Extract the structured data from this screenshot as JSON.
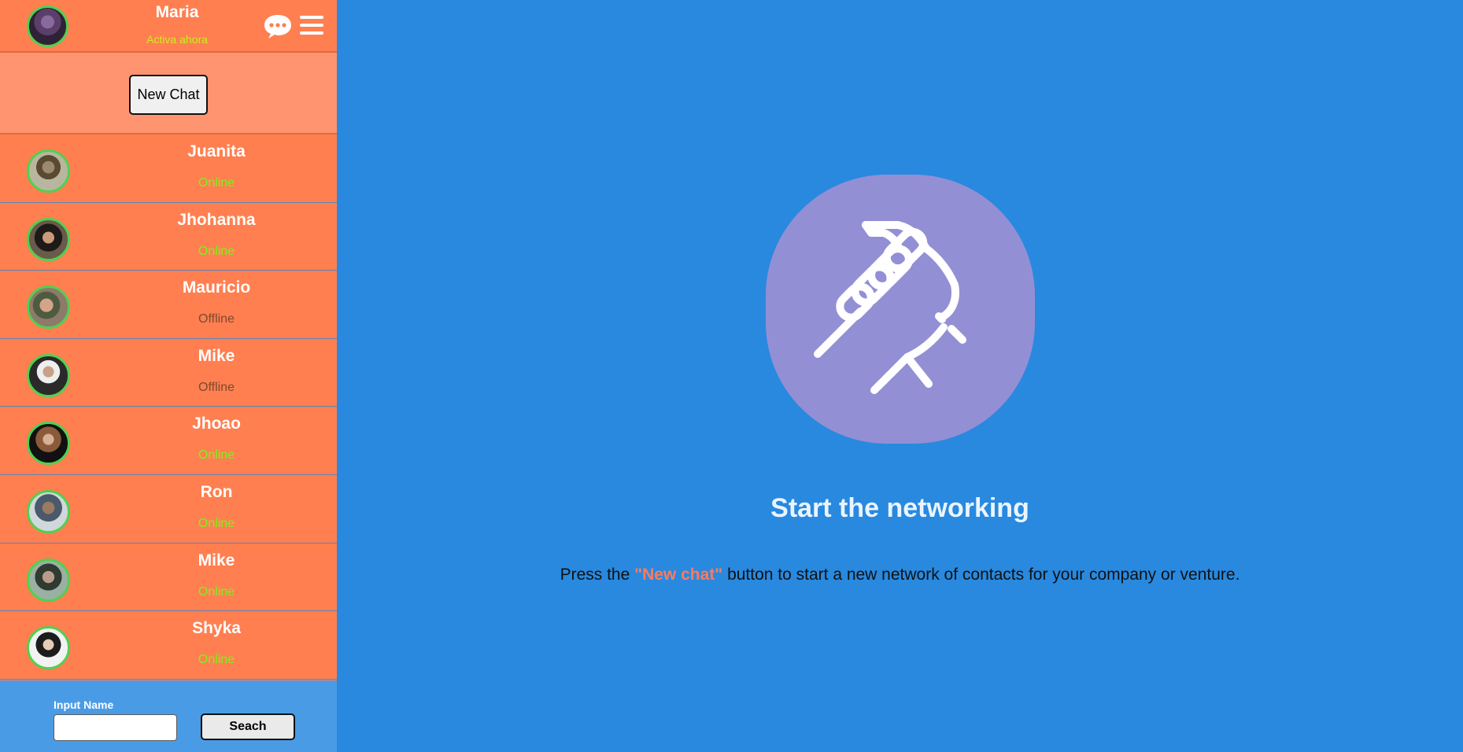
{
  "user": {
    "name": "Maria",
    "status": "Activa ahora"
  },
  "icons": {
    "chat": "chat-bubble-icon",
    "menu": "hamburger-menu-icon",
    "hero": "handshake-icon"
  },
  "new_chat_label": "New Chat",
  "contacts": [
    {
      "name": "Juanita",
      "status": "Online"
    },
    {
      "name": "Jhohanna",
      "status": "Online"
    },
    {
      "name": "Mauricio",
      "status": "Offline"
    },
    {
      "name": "Mike",
      "status": "Offline"
    },
    {
      "name": "Jhoao",
      "status": "Online"
    },
    {
      "name": "Ron",
      "status": "Online"
    },
    {
      "name": "Mike",
      "status": "Online"
    },
    {
      "name": "Shyka",
      "status": "Online"
    }
  ],
  "search": {
    "label": "Input Name",
    "value": "",
    "button_label": "Seach"
  },
  "main": {
    "title": "Start the networking",
    "desc_prefix": "Press the ",
    "desc_highlight": "\"New chat\"",
    "desc_suffix": " button to start a new network of contacts for your company or venture."
  },
  "colors": {
    "sidebar": "#ff7f50",
    "new_chat_area": "#ff9470",
    "main_bg": "#2889df",
    "hero_circle": "#938fd5",
    "online": "#7ff21c",
    "offline": "#7b4a2e",
    "highlight": "#ff7a5c"
  }
}
